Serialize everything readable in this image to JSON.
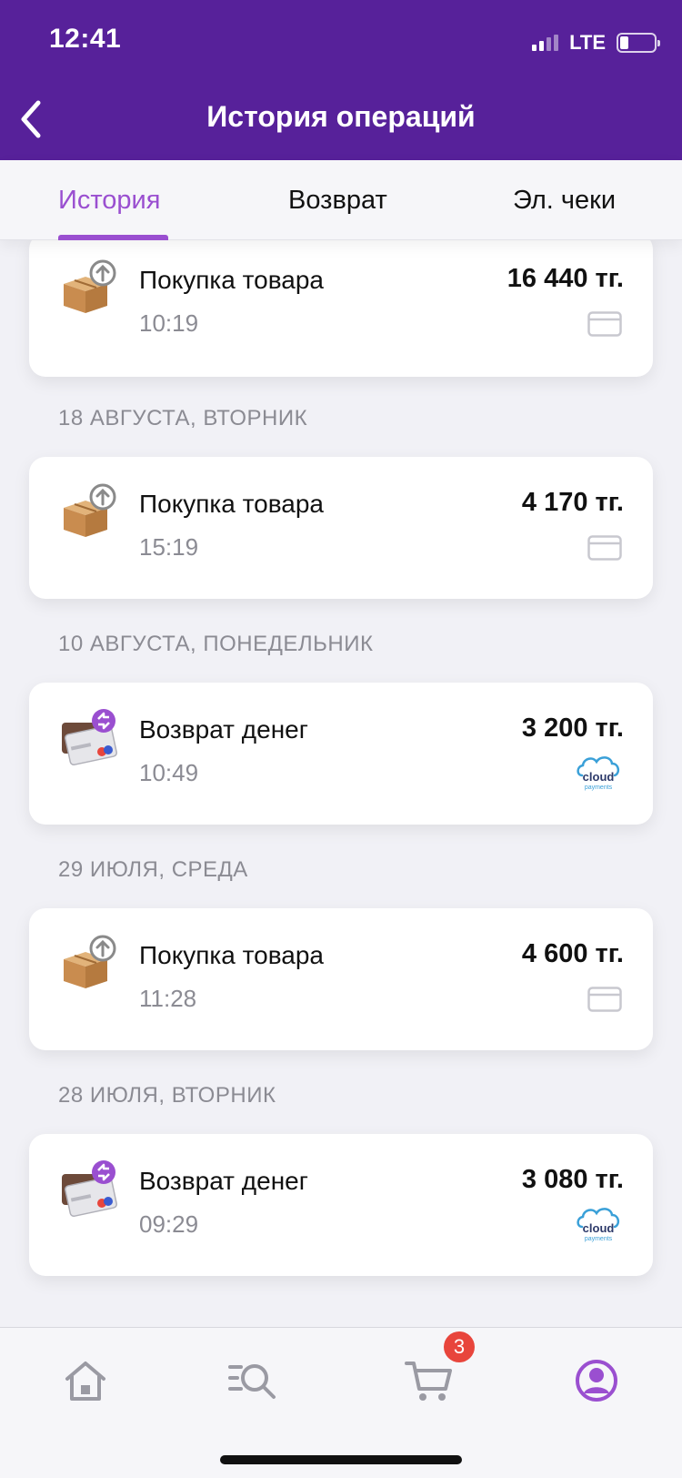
{
  "status_bar": {
    "time": "12:41",
    "network": "LTE"
  },
  "header": {
    "title": "История операций"
  },
  "tabs": [
    {
      "label": "История",
      "active": true
    },
    {
      "label": "Возврат",
      "active": false
    },
    {
      "label": "Эл. чеки",
      "active": false
    }
  ],
  "operations": [
    {
      "date": "",
      "title": "Покупка товара",
      "time": "10:19",
      "amount": "16 440 тг.",
      "type": "purchase",
      "method": "card-icon"
    },
    {
      "date": "18 АВГУСТА, ВТОРНИК",
      "title": "Покупка товара",
      "time": "15:19",
      "amount": "4 170 тг.",
      "type": "purchase",
      "method": "card-icon"
    },
    {
      "date": "10 АВГУСТА, ПОНЕДЕЛЬНИК",
      "title": "Возврат денег",
      "time": "10:49",
      "amount": "3 200 тг.",
      "type": "refund",
      "method": "cloudpayments-logo"
    },
    {
      "date": "29 ИЮЛЯ, СРЕДА",
      "title": "Покупка товара",
      "time": "11:28",
      "amount": "4 600 тг.",
      "type": "purchase",
      "method": "card-icon"
    },
    {
      "date": "28 ИЮЛЯ, ВТОРНИК",
      "title": "Возврат денег",
      "time": "09:29",
      "amount": "3 080 тг.",
      "type": "refund",
      "method": "cloudpayments-logo"
    }
  ],
  "cloud_logo": {
    "word": "cloud",
    "sub": "payments"
  },
  "tabbar": {
    "items": [
      "home-icon",
      "catalog-search-icon",
      "cart-icon",
      "profile-icon"
    ],
    "cart_badge": "3",
    "active": "profile-icon"
  },
  "colors": {
    "header": "#57219a",
    "accent": "#9a4fd0",
    "badge": "#e8453c"
  }
}
